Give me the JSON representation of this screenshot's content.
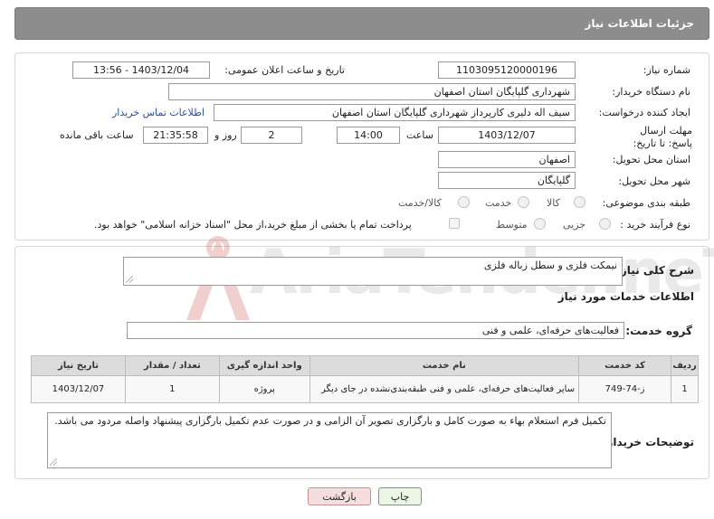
{
  "header": {
    "title": "جزئیات اطلاعات نیاز"
  },
  "form": {
    "need_number_label": "شماره نیاز:",
    "need_number": "1103095120000196",
    "announce_label": "تاریخ و ساعت اعلان عمومی:",
    "announce_value": "1403/12/04 - 13:56",
    "buyer_label": "نام دستگاه خریدار:",
    "buyer_value": "شهرداری گلپایگان استان اصفهان",
    "requester_label": "ایجاد کننده درخواست:",
    "requester_value": "سیف اله دلیری کارپرداز شهرداری گلپایگان استان اصفهان",
    "contact_link": "اطلاعات تماس خریدار",
    "deadline_label": "مهلت ارسال پاسخ: تا تاریخ:",
    "deadline_date": "1403/12/07",
    "time_label": "ساعت",
    "deadline_time": "14:00",
    "days_value": "2",
    "days_label": "روز و",
    "remaining_time": "21:35:58",
    "remaining_label": "ساعت باقی مانده",
    "province_label": "استان محل تحویل:",
    "province_value": "اصفهان",
    "city_label": "شهر محل تحویل:",
    "city_value": "گلپایگان",
    "category_label": "طبقه بندی موضوعی:",
    "category_options": [
      "کالا",
      "خدمت",
      "کالا/خدمت"
    ],
    "process_label": "نوع فرآیند خرید :",
    "process_options": [
      "جزیی",
      "متوسط"
    ],
    "payment_note": "پرداخت تمام یا بخشی از مبلغ خرید،از محل \"اسناد خزانه اسلامی\" خواهد بود."
  },
  "summary": {
    "label": "شرح کلی نیاز:",
    "value": "نیمکت فلزی و سطل زباله فلزی"
  },
  "services": {
    "section_title": "اطلاعات خدمات مورد نیاز",
    "group_label": "گروه خدمت:",
    "group_value": "فعالیت‌های حرفه‌ای، علمی و فنی",
    "columns": {
      "row": "ردیف",
      "code": "کد خدمت",
      "name": "نام خدمت",
      "unit": "واحد اندازه گیری",
      "count": "تعداد / مقدار",
      "date": "تاریخ نیاز"
    },
    "rows": [
      {
        "row": "1",
        "code": "ز-74-749",
        "name": "سایر فعالیت‌های حرفه‌ای، علمی و فنی طبقه‌بندی‌نشده در جای دیگر",
        "unit": "پروژه",
        "count": "1",
        "date": "1403/12/07"
      }
    ]
  },
  "buyer_notes": {
    "label": "توضیحات خریدار:",
    "value": "تکمیل فرم استعلام بهاء به صورت کامل و بارگزاری تصویر آن الزامی و در صورت عدم تکمیل بارگزاری پیشنهاد واصله مردود می باشد."
  },
  "buttons": {
    "print": "چاپ",
    "back": "بازگشت"
  },
  "watermark": {
    "text": "AriaTender.neT"
  },
  "colors": {
    "header_bg": "#8d8d8d",
    "link": "#2d4fa0",
    "back_button_bg": "#f7dede",
    "print_button_bg": "#eaf7e4",
    "watermark": "#c62828"
  }
}
